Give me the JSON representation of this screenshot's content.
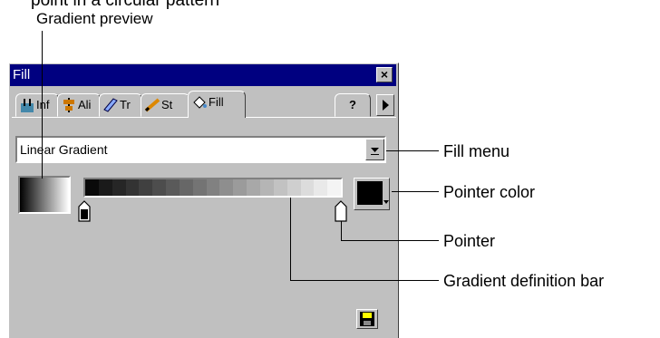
{
  "captions": {
    "top_cutoff": "point in a circular pattern",
    "gradient_preview": "Gradient preview"
  },
  "panel": {
    "title": "Fill",
    "close_glyph": "×",
    "tabs": [
      {
        "label": "Inf",
        "icon": "info-icon"
      },
      {
        "label": "Ali",
        "icon": "align-icon"
      },
      {
        "label": "Tr",
        "icon": "transform-icon"
      },
      {
        "label": "St",
        "icon": "stroke-icon"
      },
      {
        "label": "Fill",
        "icon": "paint-bucket-icon",
        "active": true
      },
      {
        "label": "?",
        "icon": "help-icon"
      }
    ],
    "fill_menu_value": "Linear Gradient",
    "gradient_colors": [
      "#0a0a0a",
      "#1a1a1a",
      "#262626",
      "#333333",
      "#404040",
      "#4d4d4d",
      "#5a5a5a",
      "#676767",
      "#747474",
      "#818181",
      "#8e8e8e",
      "#9b9b9b",
      "#a8a8a8",
      "#b5b5b5",
      "#c2c2c2",
      "#cfcfcf",
      "#dcdcdc",
      "#e9e9e9",
      "#f4f4f4"
    ],
    "pointer_color": "#000000",
    "left_pointer_fill": "#000000",
    "right_pointer_fill": "#ffffff"
  },
  "callouts": {
    "fill_menu": "Fill menu",
    "pointer_color": "Pointer color",
    "pointer": "Pointer",
    "gradient_definition_bar": "Gradient definition bar"
  },
  "colors": {
    "titlebar": "#000080",
    "panel": "#c0c0c0",
    "callout_line": "#000000"
  }
}
